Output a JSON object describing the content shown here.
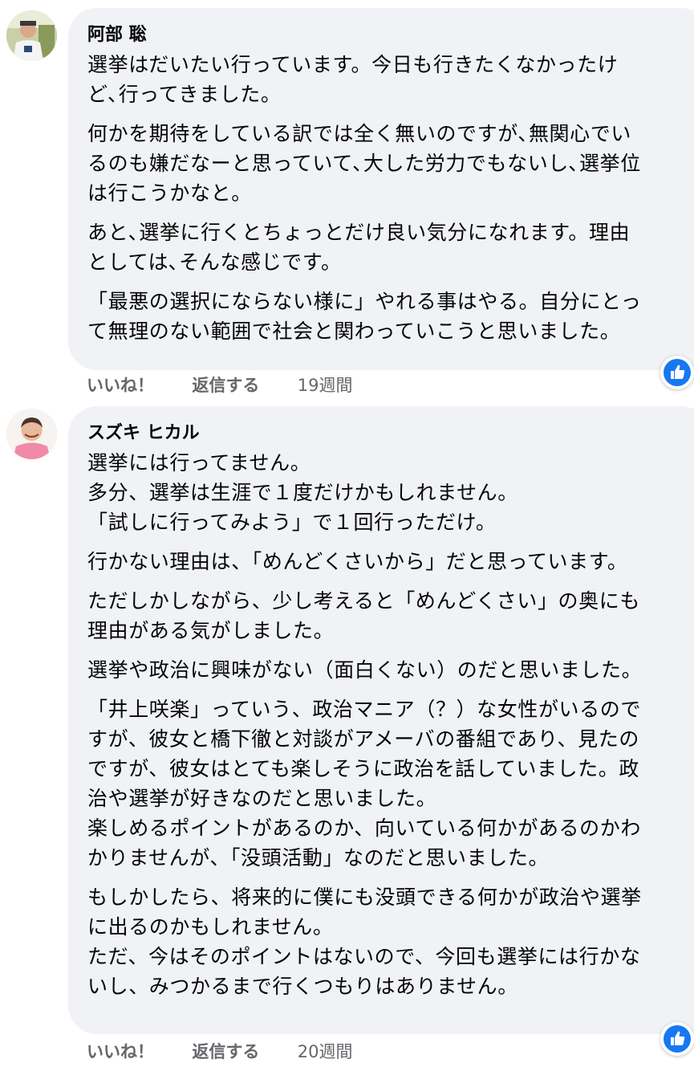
{
  "comments": [
    {
      "author": "阿部 聡",
      "paragraphs": [
        "選挙はだいたい行っています。今日も行きたくなかったけ\nど､行ってきました。",
        "何かを期待をしている訳では全く無いのですが､無関心でい\nるのも嫌だなーと思っていて､大した労力でもないし､選挙位\nは行こうかなと。",
        "あと､選挙に行くとちょっとだけ良い気分になれます。理由\nとしては､そんな感じです。",
        "「最悪の選択にならない様に」やれる事はやる。自分にとっ\nて無理のない範囲で社会と関わっていこうと思いました。"
      ],
      "like_label": "いいね！",
      "reply_label": "返信する",
      "time": "19週間",
      "reaction_icon": "like-icon"
    },
    {
      "author": "スズキ ヒカル",
      "paragraphs": [
        "選挙には行ってません。\n多分、選挙は生涯で１度だけかもしれません。\n「試しに行ってみよう」で１回行っただけ。",
        "行かない理由は、「めんどくさいから」だと思っています。",
        "ただしかしながら、少し考えると「めんどくさい」の奥にも\n理由がある気がしました。",
        "選挙や政治に興味がない（面白くない）のだと思いました。",
        "「井上咲楽」っていう、政治マニア（？）な女性がいるので\nすが、彼女と橋下徹と対談がアメーバの番組であり、見たの\nですが、彼女はとても楽しそうに政治を話していました。政\n治や選挙が好きなのだと思いました。\n楽しめるポイントがあるのか、向いている何かがあるのかわ\nかりませんが、「没頭活動」なのだと思いました。",
        "もしかしたら、将来的に僕にも没頭できる何かが政治や選挙\nに出るのかもしれません。\nただ、今はそのポイントはないので、今回も選挙には行かな\nいし、みつかるまで行くつもりはありません。"
      ],
      "like_label": "いいね！",
      "reply_label": "返信する",
      "time": "20週間",
      "reaction_icon": "like-icon"
    }
  ],
  "colors": {
    "bubble_bg": "#f0f2f5",
    "meta_text": "#65676b",
    "like_blue": "#1877f2"
  }
}
